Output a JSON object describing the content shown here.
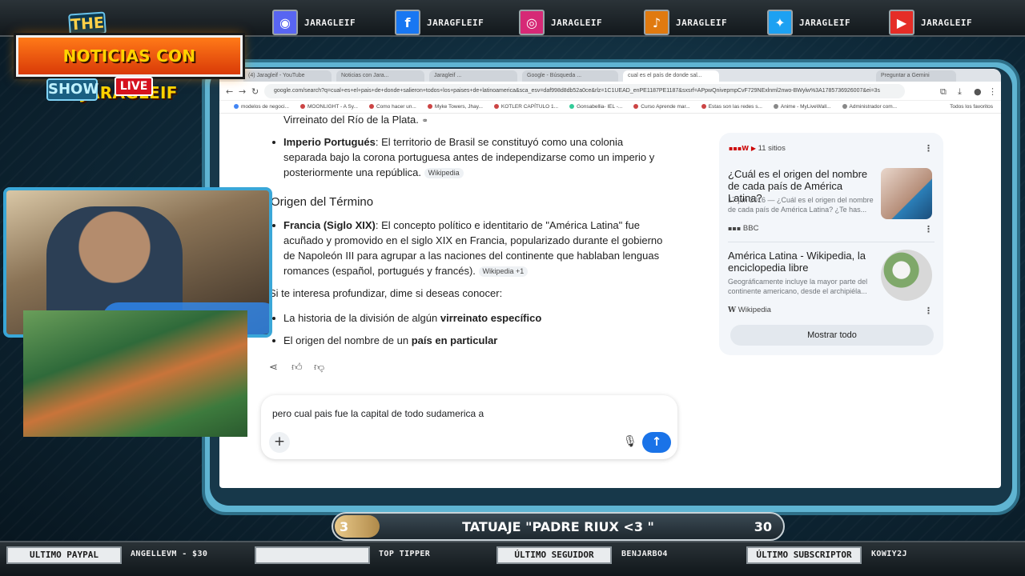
{
  "overlay": {
    "logo": {
      "the": "THE",
      "title": "NOTICIAS CON JARAGLEIF",
      "show": "SHOW",
      "live": "LIVE"
    },
    "socials": [
      {
        "icon": "discord-icon",
        "glyph": "◉",
        "color": "#5865f2",
        "handle": "JARAGLEIF"
      },
      {
        "icon": "facebook-icon",
        "glyph": "f",
        "color": "#1877f2",
        "handle": "JARAGFLEIF"
      },
      {
        "icon": "instagram-icon",
        "glyph": "◎",
        "color": "#d62976",
        "handle": "JARAGLEIF"
      },
      {
        "icon": "tiktok-icon",
        "glyph": "♪",
        "color": "#e07a10",
        "handle": "JARAGLEIF"
      },
      {
        "icon": "twitter-icon",
        "glyph": "✦",
        "color": "#1da1f2",
        "handle": "JARAGLEIF"
      },
      {
        "icon": "youtube-icon",
        "glyph": "▶",
        "color": "#e52d27",
        "handle": "JARAGLEIF"
      }
    ],
    "goal": {
      "current": "3",
      "title": "TATUAJE \"PADRE RIUX <3 \"",
      "target": "30",
      "progress": 0.1
    },
    "bottom": {
      "paypal_label": "ULTIMO PAYPAL",
      "paypal_value": "ANGELLEVM - $30",
      "tipper_label": "",
      "tipper_value": "TOP TIPPER",
      "follower_label": "ÚLTIMO SEGUIDOR",
      "follower_value": "BENJARBO4",
      "sub_label": "ÚLTIMO SUBSCRIPTOR",
      "sub_value": "KOWIY2J"
    }
  },
  "browser": {
    "tabs": [
      "(4) Jaragleif - YouTube",
      "Noticias con Jara...",
      "Jaragleif ...",
      "Google - Búsqueda ...",
      "cual es el país de donde sal...",
      "Preguntar a Gemini"
    ],
    "url": "google.com/search?q=cual+es+el+pais+de+donde+salieron+todos+los+paises+de+latinoamerica&sca_esv=daf998d8db52a0ce&rlz=1C1UEAD_enPE1187PE1187&sxsrf=APpwQnivepmpCvF729NExlnml2nwo-BWylw%3A1785736926007&ei=3s",
    "bookmarks": [
      "modelos de negoci...",
      "MOONLIGHT - A Sy...",
      "Como hacer un...",
      "Myke Towers, Jhay...",
      "KOTLER CAPÍTULO 1...",
      "Gonsabellia- IEL -...",
      "Curso Aprende mar...",
      "Estas son las redes s...",
      "Anime - MyLiveWall...",
      "Administrador com..."
    ],
    "bookmarks_right": "Todos los favoritos"
  },
  "answer": {
    "line_top": "Virreinato del Río de la Plata.",
    "imperio_bold": "Imperio Portugués",
    "imperio_text": ": El territorio de Brasil se constituyó como una colonia separada bajo la corona portuguesa antes de independizarse como un imperio y posteriormente una república.",
    "chip_wiki": "Wikipedia",
    "heading": "Origen del Término",
    "francia_bold": "Francia (Siglo XIX)",
    "francia_text": ": El concepto político e identitario de \"América Latina\" fue acuñado y promovido en el siglo XIX en Francia, popularizado durante el gobierno de Napoleón III para agrupar a las naciones del continente que hablaban lenguas romances (español, portugués y francés).",
    "chip_wiki_plus": "Wikipedia +1",
    "followup_intro": "Si te interesa profundizar, dime si deseas conocer:",
    "opt1_text": "La historia de la división de algún ",
    "opt1_bold": "virreinato específico",
    "opt2_text": "El origen del nombre de un ",
    "opt2_bold": "país en particular"
  },
  "sources": {
    "count": "11 sitios",
    "items": [
      {
        "title": "¿Cuál es el origen del nombre de cada país de América Latina?",
        "snippet": "17 jun 2016 — ¿Cuál es el origen del nombre de cada país de América Latina? ¿Te has...",
        "site": "BBC"
      },
      {
        "title": "América Latina - Wikipedia, la enciclopedia libre",
        "snippet": "Geográficamente incluye la mayor parte del continente americano, desde el archipiéla...",
        "site": "Wikipedia"
      }
    ],
    "show_all": "Mostrar todo"
  },
  "input": {
    "value": "pero cual pais fue la capital de todo sudamerica a"
  }
}
